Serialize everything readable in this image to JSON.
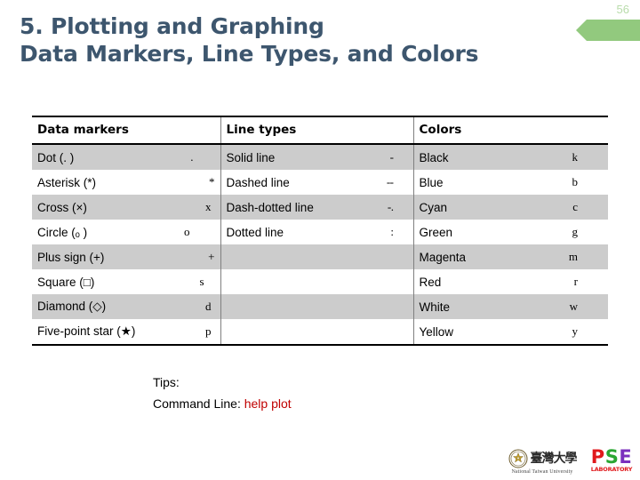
{
  "slide": {
    "title_line1": "5. Plotting and Graphing",
    "title_line2": "Data Markers, Line Types, and Colors",
    "title_color": "#3d566e",
    "page_number": "56",
    "badge_color": "#92c97e"
  },
  "table": {
    "headers": {
      "data_markers": "Data markers",
      "line_types": "Line types",
      "colors": "Colors"
    },
    "data_markers": [
      {
        "name": "Dot (. )",
        "symbol": "."
      },
      {
        "name": "Asterisk (*)",
        "symbol": "*"
      },
      {
        "name": "Cross (×)",
        "symbol": "x"
      },
      {
        "name": "Circle (ₒ )",
        "symbol": "o"
      },
      {
        "name": "Plus sign (+)",
        "symbol": "+"
      },
      {
        "name": "Square (□)",
        "symbol": "s"
      },
      {
        "name": "Diamond (◇)",
        "symbol": "d"
      },
      {
        "name": "Five-point star (★)",
        "symbol": "p"
      }
    ],
    "line_types": [
      {
        "name": "Solid line",
        "symbol": "-"
      },
      {
        "name": "Dashed line",
        "symbol": "--"
      },
      {
        "name": "Dash-dotted line",
        "symbol": "-."
      },
      {
        "name": "Dotted line",
        "symbol": ":"
      },
      {
        "name": "",
        "symbol": ""
      },
      {
        "name": "",
        "symbol": ""
      },
      {
        "name": "",
        "symbol": ""
      },
      {
        "name": "",
        "symbol": ""
      }
    ],
    "colors": [
      {
        "name": "Black",
        "symbol": "k"
      },
      {
        "name": "Blue",
        "symbol": "b"
      },
      {
        "name": "Cyan",
        "symbol": "c"
      },
      {
        "name": "Green",
        "symbol": "g"
      },
      {
        "name": "Magenta",
        "symbol": "m"
      },
      {
        "name": "Red",
        "symbol": "r"
      },
      {
        "name": "White",
        "symbol": "w"
      },
      {
        "name": "Yellow",
        "symbol": "y"
      }
    ]
  },
  "tips": {
    "heading": "Tips:",
    "command_label": "Command Line:",
    "command_value": "help plot",
    "highlight_color": "#c00000"
  },
  "footer": {
    "ntu_chinese": "臺灣大學",
    "ntu_english": "National Taiwan University",
    "pse_p": "P",
    "pse_s": "S",
    "pse_e": "E",
    "pse_sub": "LABORATORY"
  }
}
